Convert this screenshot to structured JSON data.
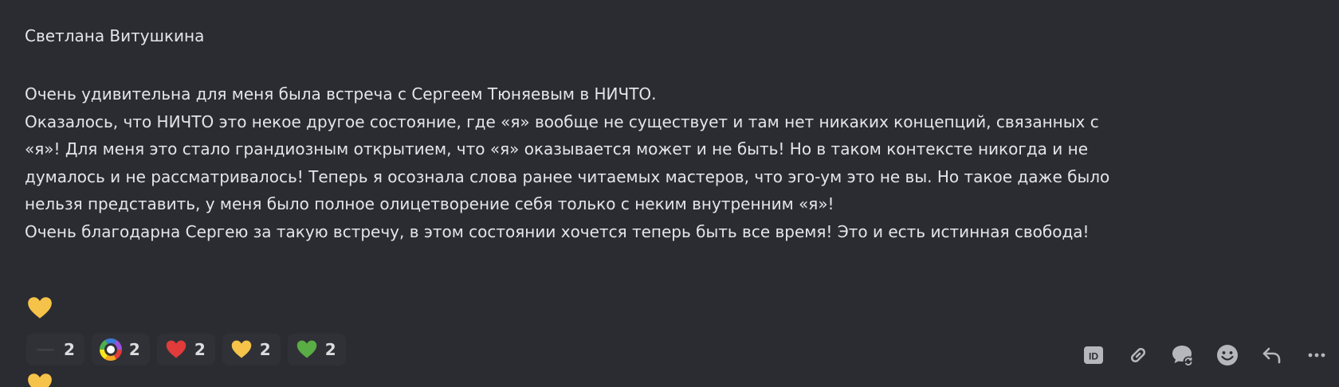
{
  "message": {
    "author": "Светлана Витушкина",
    "lines": [
      "Очень удивительна для меня была встреча с Сергеем Тюняевым в НИЧТО.",
      "Оказалось, что НИЧТО это некое другое состояние, где «я» вообще не существует и там нет никаких концепций, связанных с",
      "«я»! Для меня это стало грандиозным открытием, что «я» оказывается может и не быть! Но в таком контексте никогда и не",
      "думалось и не рассматривалось! Теперь я осознала слова ранее читаемых  мастеров, что эго-ум это не вы. Но такое даже было",
      "нельзя представить, у меня было полное олицетворение себя только с неким внутренним «я»!",
      "Очень благодарна Сергею за такую встречу, в этом состоянии хочется теперь быть все время! Это и есть истинная свобода!"
    ],
    "emoji": "yellow-heart-icon"
  },
  "reactions": [
    {
      "icon": "dash-icon",
      "count": "2"
    },
    {
      "icon": "rainbow-circle-icon",
      "count": "2"
    },
    {
      "icon": "red-heart-icon",
      "count": "2"
    },
    {
      "icon": "yellow-heart-icon",
      "count": "2"
    },
    {
      "icon": "green-heart-icon",
      "count": "2"
    }
  ],
  "toolbar": [
    {
      "icon": "id-icon"
    },
    {
      "icon": "link-icon"
    },
    {
      "icon": "thread-icon"
    },
    {
      "icon": "emoji-icon"
    },
    {
      "icon": "reply-icon"
    },
    {
      "icon": "more-icon"
    }
  ],
  "colors": {
    "background": "#2b2c31",
    "reaction_bg": "#303136",
    "text": "#e4e5e8",
    "red_heart": "#e23b3b",
    "yellow_heart": "#f5c24a",
    "green_heart": "#5aac44"
  }
}
